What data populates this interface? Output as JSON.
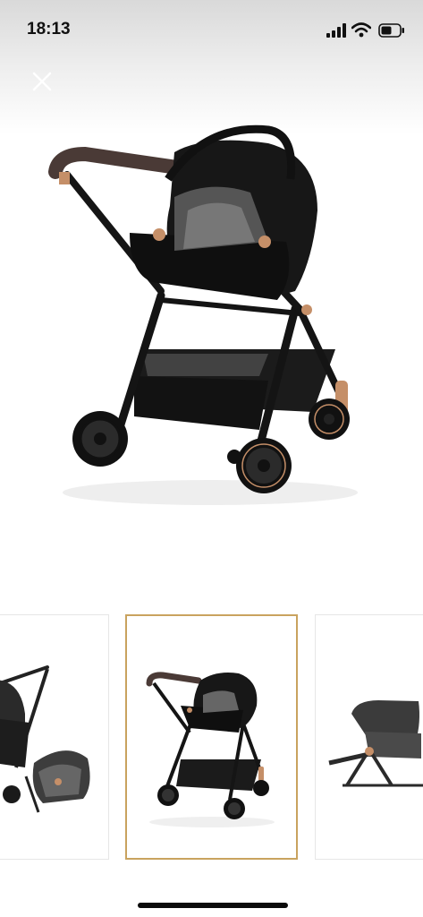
{
  "status_bar": {
    "time": "18:13",
    "icons": [
      "signal-icon",
      "wifi-icon",
      "battery-icon"
    ]
  },
  "viewer": {
    "close_icon": "close-icon",
    "selected_thumbnail": 2
  },
  "thumbnails": [
    {
      "id": 1,
      "subject": "stroller-with-seat-and-car-seat"
    },
    {
      "id": 2,
      "subject": "stroller-with-car-seat"
    },
    {
      "id": 3,
      "subject": "stroller-seat-closeup"
    }
  ],
  "colors": {
    "frame": "#1a1a1a",
    "accent_copper": "#c58f68",
    "handle_leather": "#4a3a36",
    "selected_border": "#c9a35f"
  }
}
